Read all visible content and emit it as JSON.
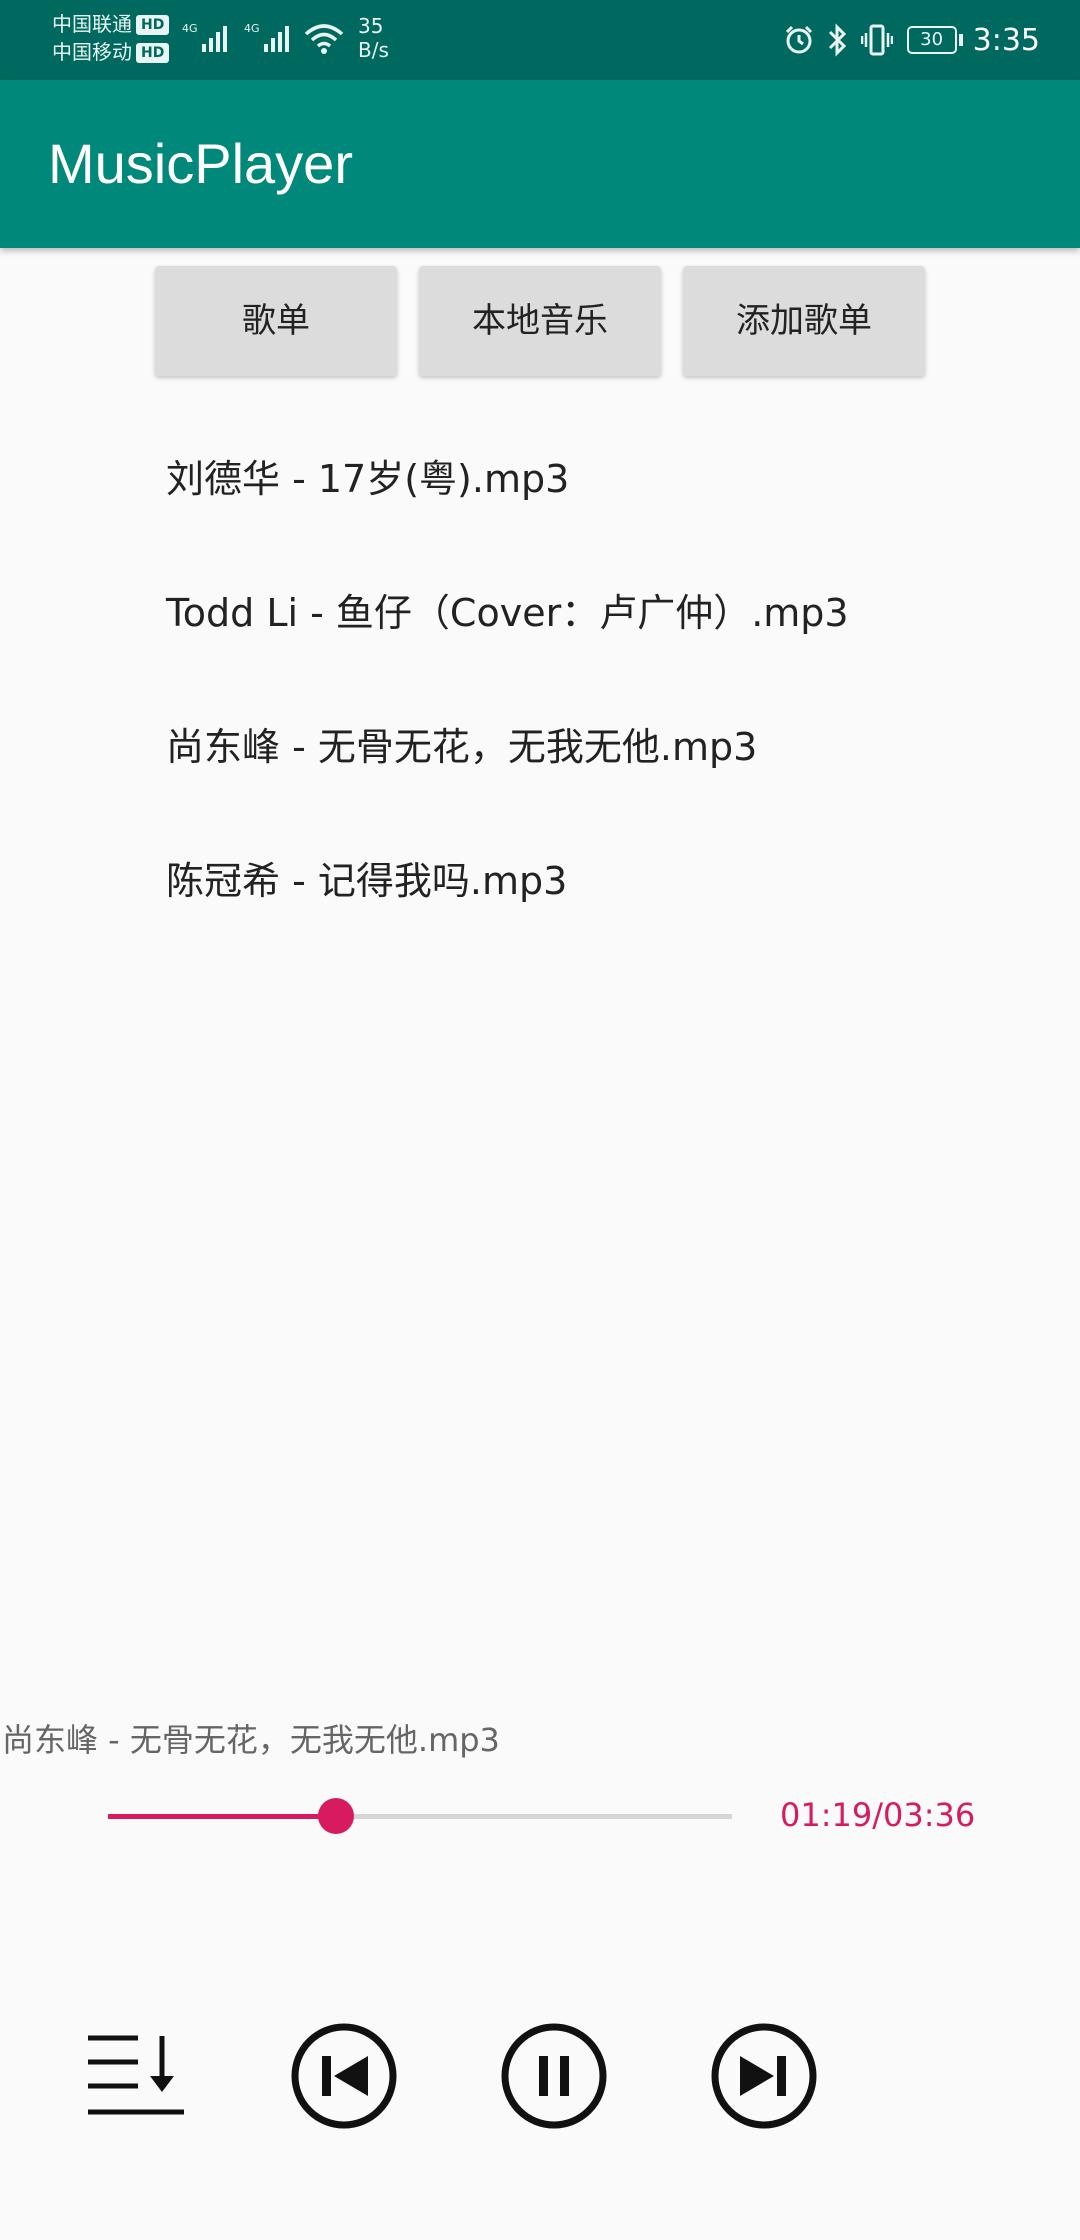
{
  "status_bar": {
    "carrier_1": "中国联通",
    "carrier_2": "中国移动",
    "hd_badge": "HD",
    "network_type": "4G",
    "net_speed_value": "35",
    "net_speed_unit": "B/s",
    "battery_level": "30",
    "time": "3:35",
    "icons": [
      "alarm-icon",
      "bluetooth-icon",
      "vibrate-icon",
      "battery-icon",
      "wifi-icon",
      "signal-icon"
    ]
  },
  "app_bar": {
    "title": "MusicPlayer",
    "color": "#00897b"
  },
  "buttons": {
    "playlist": "歌单",
    "local_music": "本地音乐",
    "add_playlist": "添加歌单"
  },
  "songs": [
    "刘德华 - 17岁(粤).mp3",
    "Todd Li - 鱼仔（Cover：卢广仲）.mp3",
    "尚东峰 - 无骨无花，无我无他.mp3",
    "陈冠希 - 记得我吗.mp3"
  ],
  "player": {
    "now_playing": "尚东峰 - 无骨无花，无我无他.mp3",
    "time_display": "01:19/03:36",
    "progress_fraction": 0.366,
    "accent_color": "#d81b60",
    "controls": [
      "playlist-order-icon",
      "previous-icon",
      "pause-icon",
      "next-icon"
    ]
  }
}
